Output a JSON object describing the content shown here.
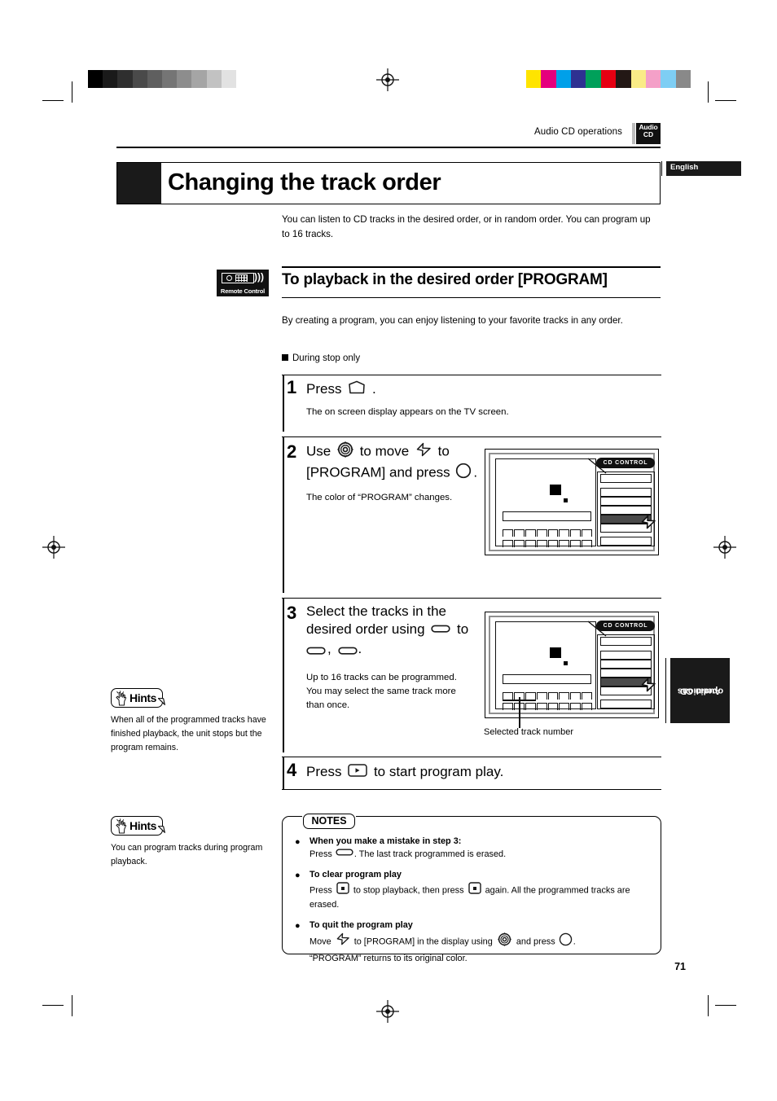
{
  "print_marks": {
    "grey_ramp": [
      "#000000",
      "#1a1a1a",
      "#2f2f2f",
      "#4a4a4a",
      "#5f5f5f",
      "#757575",
      "#8d8d8d",
      "#a5a5a5",
      "#c2c2c2",
      "#e2e2e2",
      "#ffffff"
    ],
    "color_ramp": [
      "#ffe400",
      "#e5007d",
      "#00a0e9",
      "#2e3192",
      "#00a05a",
      "#e60012",
      "#231815",
      "#faec87",
      "#f4a0c8",
      "#7ecef4",
      "#898989"
    ]
  },
  "header": {
    "section_label": "Audio CD operations",
    "badge_line1": "Audio",
    "badge_line2": "CD",
    "language_tab": "English"
  },
  "side_tab": {
    "line1": "Audio CD",
    "line2": "operations"
  },
  "title": "Changing the track order",
  "intro": "You can listen to CD tracks in the desired order, or in random order.  You can program up to 16 tracks.",
  "remote_icon_caption": "Remote Control",
  "section": {
    "heading": "To playback in the desired order [PROGRAM]",
    "paragraph": "By creating a program, you can enjoy listening to your favorite tracks in any order.",
    "condition": "During stop only"
  },
  "steps": [
    {
      "number": "1",
      "text_before": "Press",
      "icon": "osd-button-icon",
      "text_after": ".",
      "sub": "The on screen display appears on the TV screen."
    },
    {
      "number": "2",
      "line1_a": "Use",
      "line1_icon": "joystick-icon",
      "line1_b": "to move",
      "line1_icon2": "cursor-arrow-icon",
      "line1_c": "to",
      "line2_a": "[PROGRAM] and press",
      "line2_icon": "enter-button-icon",
      "line2_b": ".",
      "sub": "The color of “PROGRAM” changes."
    },
    {
      "number": "3",
      "line1": "Select the tracks in the",
      "line2_a": "desired order using",
      "line2_icon": "oval-button-icon",
      "line2_b": "to",
      "line3_icon_a": "oval-button-icon",
      "line3_sep": ",",
      "line3_icon_b": "oval-button-icon",
      "line3_end": ".",
      "sub": "Up to 16 tracks can be programmed. You may select the same track more than once.",
      "figure_caption": "Selected track number"
    },
    {
      "number": "4",
      "text_before": "Press",
      "icon": "play-button-icon",
      "text_after": "to start program play."
    }
  ],
  "figures": {
    "osd_panel_label": "CD CONTROL"
  },
  "hints": [
    {
      "label": "Hints",
      "body": "When all of the programmed tracks have finished playback, the unit stops but the program remains."
    },
    {
      "label": "Hints",
      "body": "You can program tracks during program playback."
    }
  ],
  "notes": {
    "label": "NOTES",
    "items": [
      {
        "head": "When you make a mistake in step 3:",
        "body_a": "Press",
        "icon_a": "oval-button-icon",
        "body_b": ". The last track programmed is erased."
      },
      {
        "head": "To clear program play",
        "body_a": "Press",
        "icon_a": "stop-button-icon",
        "body_b": "to stop playback, then press",
        "icon_b": "stop-button-icon",
        "body_c": "again.  All the programmed tracks are erased."
      },
      {
        "head": "To quit the program play",
        "body_a": "Move",
        "icon_a": "cursor-arrow-icon",
        "body_b": "to [PROGRAM] in the display using",
        "icon_b": "joystick-icon",
        "body_c": "and press",
        "icon_c": "enter-button-icon",
        "body_d": ".",
        "body_e": "“PROGRAM” returns to its original color."
      }
    ]
  },
  "page_number": "71"
}
